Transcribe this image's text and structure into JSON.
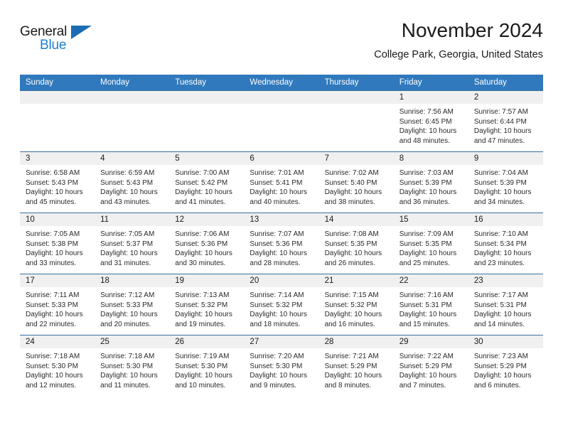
{
  "brand": {
    "name_part1": "General",
    "name_part2": "Blue",
    "accent_color": "#1c7fd0",
    "triangle_color": "#1c6cb4"
  },
  "header": {
    "month_title": "November 2024",
    "location": "College Park, Georgia, United States",
    "header_bar_color": "#3079bd"
  },
  "weekday_headers": [
    "Sunday",
    "Monday",
    "Tuesday",
    "Wednesday",
    "Thursday",
    "Friday",
    "Saturday"
  ],
  "weeks": [
    [
      {
        "day": "",
        "sunrise": "",
        "sunset": "",
        "daylight1": "",
        "daylight2": "",
        "empty": true
      },
      {
        "day": "",
        "sunrise": "",
        "sunset": "",
        "daylight1": "",
        "daylight2": "",
        "empty": true
      },
      {
        "day": "",
        "sunrise": "",
        "sunset": "",
        "daylight1": "",
        "daylight2": "",
        "empty": true
      },
      {
        "day": "",
        "sunrise": "",
        "sunset": "",
        "daylight1": "",
        "daylight2": "",
        "empty": true
      },
      {
        "day": "",
        "sunrise": "",
        "sunset": "",
        "daylight1": "",
        "daylight2": "",
        "empty": true
      },
      {
        "day": "1",
        "sunrise": "Sunrise: 7:56 AM",
        "sunset": "Sunset: 6:45 PM",
        "daylight1": "Daylight: 10 hours",
        "daylight2": "and 48 minutes."
      },
      {
        "day": "2",
        "sunrise": "Sunrise: 7:57 AM",
        "sunset": "Sunset: 6:44 PM",
        "daylight1": "Daylight: 10 hours",
        "daylight2": "and 47 minutes."
      }
    ],
    [
      {
        "day": "3",
        "sunrise": "Sunrise: 6:58 AM",
        "sunset": "Sunset: 5:43 PM",
        "daylight1": "Daylight: 10 hours",
        "daylight2": "and 45 minutes."
      },
      {
        "day": "4",
        "sunrise": "Sunrise: 6:59 AM",
        "sunset": "Sunset: 5:43 PM",
        "daylight1": "Daylight: 10 hours",
        "daylight2": "and 43 minutes."
      },
      {
        "day": "5",
        "sunrise": "Sunrise: 7:00 AM",
        "sunset": "Sunset: 5:42 PM",
        "daylight1": "Daylight: 10 hours",
        "daylight2": "and 41 minutes."
      },
      {
        "day": "6",
        "sunrise": "Sunrise: 7:01 AM",
        "sunset": "Sunset: 5:41 PM",
        "daylight1": "Daylight: 10 hours",
        "daylight2": "and 40 minutes."
      },
      {
        "day": "7",
        "sunrise": "Sunrise: 7:02 AM",
        "sunset": "Sunset: 5:40 PM",
        "daylight1": "Daylight: 10 hours",
        "daylight2": "and 38 minutes."
      },
      {
        "day": "8",
        "sunrise": "Sunrise: 7:03 AM",
        "sunset": "Sunset: 5:39 PM",
        "daylight1": "Daylight: 10 hours",
        "daylight2": "and 36 minutes."
      },
      {
        "day": "9",
        "sunrise": "Sunrise: 7:04 AM",
        "sunset": "Sunset: 5:39 PM",
        "daylight1": "Daylight: 10 hours",
        "daylight2": "and 34 minutes."
      }
    ],
    [
      {
        "day": "10",
        "sunrise": "Sunrise: 7:05 AM",
        "sunset": "Sunset: 5:38 PM",
        "daylight1": "Daylight: 10 hours",
        "daylight2": "and 33 minutes."
      },
      {
        "day": "11",
        "sunrise": "Sunrise: 7:05 AM",
        "sunset": "Sunset: 5:37 PM",
        "daylight1": "Daylight: 10 hours",
        "daylight2": "and 31 minutes."
      },
      {
        "day": "12",
        "sunrise": "Sunrise: 7:06 AM",
        "sunset": "Sunset: 5:36 PM",
        "daylight1": "Daylight: 10 hours",
        "daylight2": "and 30 minutes."
      },
      {
        "day": "13",
        "sunrise": "Sunrise: 7:07 AM",
        "sunset": "Sunset: 5:36 PM",
        "daylight1": "Daylight: 10 hours",
        "daylight2": "and 28 minutes."
      },
      {
        "day": "14",
        "sunrise": "Sunrise: 7:08 AM",
        "sunset": "Sunset: 5:35 PM",
        "daylight1": "Daylight: 10 hours",
        "daylight2": "and 26 minutes."
      },
      {
        "day": "15",
        "sunrise": "Sunrise: 7:09 AM",
        "sunset": "Sunset: 5:35 PM",
        "daylight1": "Daylight: 10 hours",
        "daylight2": "and 25 minutes."
      },
      {
        "day": "16",
        "sunrise": "Sunrise: 7:10 AM",
        "sunset": "Sunset: 5:34 PM",
        "daylight1": "Daylight: 10 hours",
        "daylight2": "and 23 minutes."
      }
    ],
    [
      {
        "day": "17",
        "sunrise": "Sunrise: 7:11 AM",
        "sunset": "Sunset: 5:33 PM",
        "daylight1": "Daylight: 10 hours",
        "daylight2": "and 22 minutes."
      },
      {
        "day": "18",
        "sunrise": "Sunrise: 7:12 AM",
        "sunset": "Sunset: 5:33 PM",
        "daylight1": "Daylight: 10 hours",
        "daylight2": "and 20 minutes."
      },
      {
        "day": "19",
        "sunrise": "Sunrise: 7:13 AM",
        "sunset": "Sunset: 5:32 PM",
        "daylight1": "Daylight: 10 hours",
        "daylight2": "and 19 minutes."
      },
      {
        "day": "20",
        "sunrise": "Sunrise: 7:14 AM",
        "sunset": "Sunset: 5:32 PM",
        "daylight1": "Daylight: 10 hours",
        "daylight2": "and 18 minutes."
      },
      {
        "day": "21",
        "sunrise": "Sunrise: 7:15 AM",
        "sunset": "Sunset: 5:32 PM",
        "daylight1": "Daylight: 10 hours",
        "daylight2": "and 16 minutes."
      },
      {
        "day": "22",
        "sunrise": "Sunrise: 7:16 AM",
        "sunset": "Sunset: 5:31 PM",
        "daylight1": "Daylight: 10 hours",
        "daylight2": "and 15 minutes."
      },
      {
        "day": "23",
        "sunrise": "Sunrise: 7:17 AM",
        "sunset": "Sunset: 5:31 PM",
        "daylight1": "Daylight: 10 hours",
        "daylight2": "and 14 minutes."
      }
    ],
    [
      {
        "day": "24",
        "sunrise": "Sunrise: 7:18 AM",
        "sunset": "Sunset: 5:30 PM",
        "daylight1": "Daylight: 10 hours",
        "daylight2": "and 12 minutes."
      },
      {
        "day": "25",
        "sunrise": "Sunrise: 7:18 AM",
        "sunset": "Sunset: 5:30 PM",
        "daylight1": "Daylight: 10 hours",
        "daylight2": "and 11 minutes."
      },
      {
        "day": "26",
        "sunrise": "Sunrise: 7:19 AM",
        "sunset": "Sunset: 5:30 PM",
        "daylight1": "Daylight: 10 hours",
        "daylight2": "and 10 minutes."
      },
      {
        "day": "27",
        "sunrise": "Sunrise: 7:20 AM",
        "sunset": "Sunset: 5:30 PM",
        "daylight1": "Daylight: 10 hours",
        "daylight2": "and 9 minutes."
      },
      {
        "day": "28",
        "sunrise": "Sunrise: 7:21 AM",
        "sunset": "Sunset: 5:29 PM",
        "daylight1": "Daylight: 10 hours",
        "daylight2": "and 8 minutes."
      },
      {
        "day": "29",
        "sunrise": "Sunrise: 7:22 AM",
        "sunset": "Sunset: 5:29 PM",
        "daylight1": "Daylight: 10 hours",
        "daylight2": "and 7 minutes."
      },
      {
        "day": "30",
        "sunrise": "Sunrise: 7:23 AM",
        "sunset": "Sunset: 5:29 PM",
        "daylight1": "Daylight: 10 hours",
        "daylight2": "and 6 minutes."
      }
    ]
  ]
}
